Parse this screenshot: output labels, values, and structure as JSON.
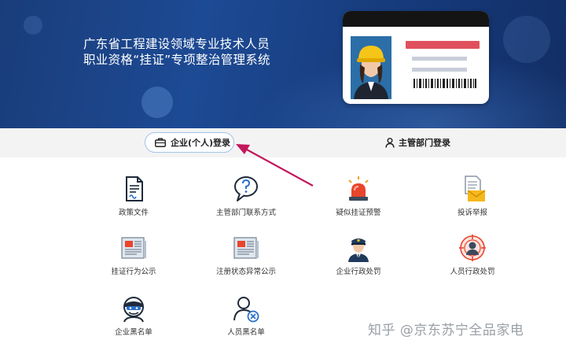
{
  "banner": {
    "title_line1": "广东省工程建设领域专业技术人员",
    "title_line2": "职业资格“挂证”专项整治管理系统"
  },
  "login": {
    "enterprise_label": "企业(个人)登录",
    "authority_label": "主管部门登录"
  },
  "features": [
    {
      "label": "政策文件",
      "icon": "document-icon"
    },
    {
      "label": "主管部门联系方式",
      "icon": "question-bubble-icon"
    },
    {
      "label": "疑似挂证预警",
      "icon": "siren-icon"
    },
    {
      "label": "投诉举报",
      "icon": "envelope-letter-icon"
    },
    {
      "label": "挂证行为公示",
      "icon": "newspaper-icon"
    },
    {
      "label": "注册状态异常公示",
      "icon": "newspaper-icon"
    },
    {
      "label": "企业行政处罚",
      "icon": "police-officer-icon"
    },
    {
      "label": "人员行政处罚",
      "icon": "target-person-icon"
    },
    {
      "label": "企业黑名单",
      "icon": "masked-person-icon"
    },
    {
      "label": "人员黑名单",
      "icon": "person-x-icon"
    }
  ],
  "watermark": "知乎 @京东苏宁全品家电",
  "colors": {
    "banner_blue": "#1d4a94",
    "login_bar": "#f3f3f3",
    "arrow": "#c2185b",
    "accent_red": "#e0505c"
  }
}
